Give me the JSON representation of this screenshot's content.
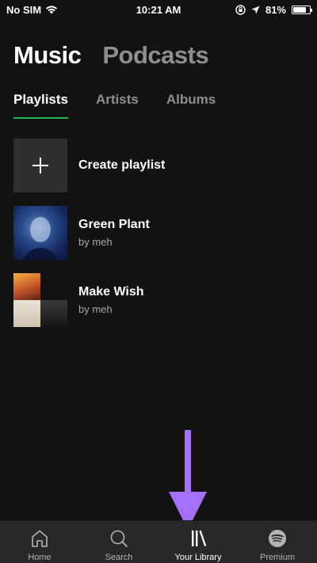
{
  "status_bar": {
    "carrier": "No SIM",
    "time": "10:21 AM",
    "battery_percent": "81%",
    "battery_level": 0.81
  },
  "header": {
    "tabs": [
      {
        "label": "Music",
        "active": true
      },
      {
        "label": "Podcasts",
        "active": false
      }
    ]
  },
  "subtabs": [
    {
      "label": "Playlists",
      "active": true
    },
    {
      "label": "Artists",
      "active": false
    },
    {
      "label": "Albums",
      "active": false
    }
  ],
  "list": {
    "create_label": "Create playlist",
    "items": [
      {
        "title": "Green Plant",
        "subtitle": "by meh"
      },
      {
        "title": "Make Wish",
        "subtitle": "by meh"
      }
    ]
  },
  "tabbar": {
    "items": [
      {
        "label": "Home",
        "icon": "home-icon",
        "active": false
      },
      {
        "label": "Search",
        "icon": "search-icon",
        "active": false
      },
      {
        "label": "Your Library",
        "icon": "library-icon",
        "active": true
      },
      {
        "label": "Premium",
        "icon": "spotify-icon",
        "active": false
      }
    ]
  },
  "colors": {
    "background": "#121212",
    "accent": "#1db954",
    "annotation_arrow": "#a370f7",
    "tabbar": "#282828"
  }
}
